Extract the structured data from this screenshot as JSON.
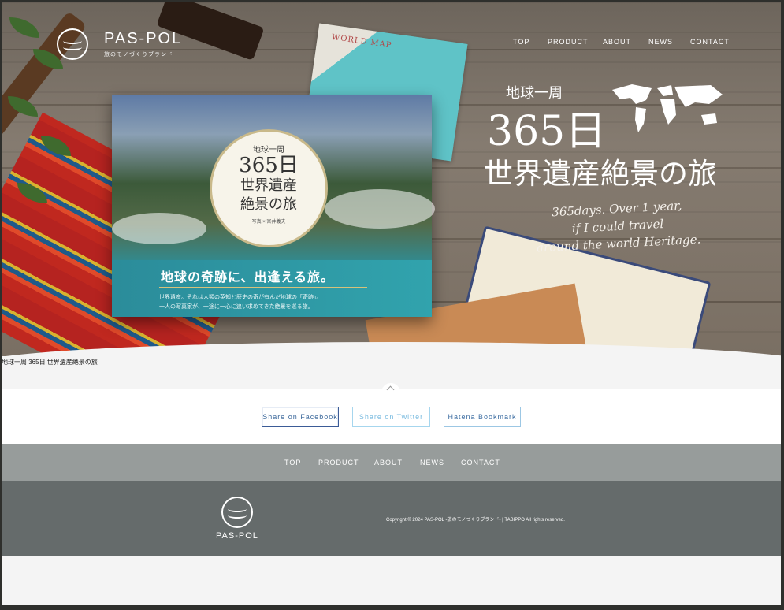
{
  "header": {
    "brand": "PAS-POL",
    "brand_sub": "旅のモノづくりブランド",
    "nav": [
      "TOP",
      "PRODUCT",
      "ABOUT",
      "NEWS",
      "CONTACT"
    ]
  },
  "hero": {
    "headline_small": "地球一周",
    "headline_big": "365日",
    "headline_mid": "世界遺産絶景の旅",
    "script_lines": [
      "365days. Over 1 year,",
      "if I could travel",
      "around the world Heritage."
    ],
    "map_label": "WORLD MAP",
    "book_circle": {
      "small": "地球一周",
      "big": "365日",
      "line1": "世界遺産",
      "line2": "絶景の旅",
      "author": "写真 × 宮井義夫"
    },
    "book_tag": "地球の奇跡に、出逢える旅。",
    "book_desc_1": "世界遺産。それは人類の英知と歴史の奇が有んだ地球の「奇跡」。",
    "book_desc_2": "一人の写真家が、一途に一心に追い求めてきた絶景を巡る旅。"
  },
  "caption": "地球一周 365日 世界遺産絶景の旅",
  "share": {
    "facebook": "Share on Facebook",
    "twitter": "Share on Twitter",
    "hatena": "Hatena Bookmark"
  },
  "footer": {
    "nav": [
      "TOP",
      "PRODUCT",
      "ABOUT",
      "NEWS",
      "CONTACT"
    ],
    "brand": "PAS-POL",
    "copyright": "Copyright © 2024 PAS-POL -旅のモノづくりブランド- | TABIPPO All rights reserved."
  },
  "colors": {
    "footer_nav_bg": "#979c9b",
    "footer_bg": "#656b6b",
    "facebook_border": "#3b5b97",
    "twitter_border": "#a6d6ee"
  }
}
